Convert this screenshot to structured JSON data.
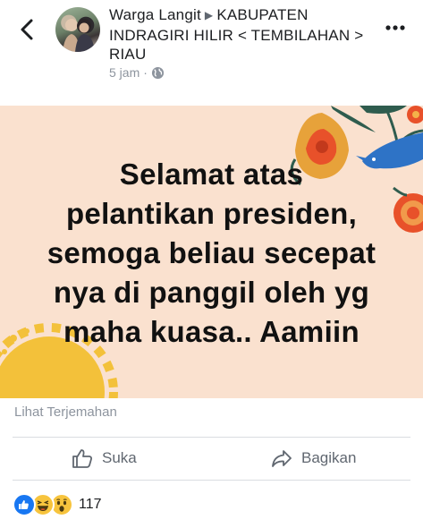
{
  "header": {
    "author": "Warga Langit",
    "separator": "▶",
    "destination": "KABUPATEN INDRAGIRI HILIR < TEMBILAHAN > RIAU",
    "time": "5 jam",
    "dot": "·",
    "privacy_icon": "globe-icon",
    "back_icon": "chevron-left-icon",
    "more_icon": "more-dots-icon"
  },
  "post": {
    "text": "Selamat atas\npelantikan presiden,\nsemoga beliau secepat\nnya di panggil oleh yg\nmaha kuasa..  Aamiin",
    "background_color": "#fae1cf"
  },
  "translate_label": "Lihat Terjemahan",
  "actions": {
    "like_label": "Suka",
    "share_label": "Bagikan"
  },
  "reactions": {
    "types": [
      "like",
      "haha",
      "wow"
    ],
    "count": "117"
  },
  "colors": {
    "like_blue": "#1877f2",
    "emoji_yellow": "#f7c43d",
    "muted_text": "#8d949e"
  }
}
